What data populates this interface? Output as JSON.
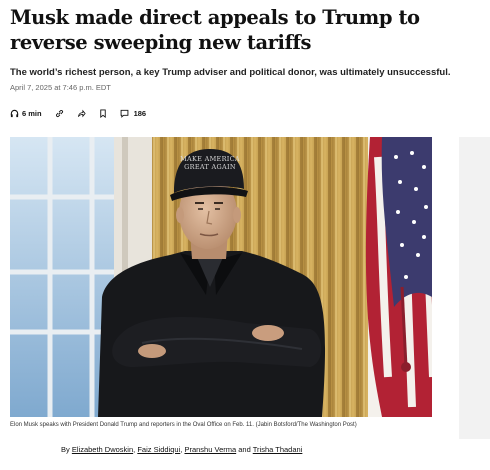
{
  "article": {
    "headline": "Musk made direct appeals to Trump to reverse sweeping new tariffs",
    "dek": "The world’s richest person, a key Trump adviser and political donor, was ultimately unsuccessful.",
    "dateline": "April 7, 2025 at 7:46 p.m. EDT"
  },
  "toolbar": {
    "listen_label": "6 min",
    "comments_count": "186",
    "icons": [
      "headphones-icon",
      "gift-link-icon",
      "share-icon",
      "bookmark-icon",
      "comment-icon"
    ]
  },
  "photo": {
    "cap_text_line1": "MAKE AMERICA",
    "cap_text_line2": "GREAT AGAIN",
    "caption": "Elon Musk speaks with President Donald Trump and reporters in the Oval Office on Feb. 11. (Jabin Botsford/The Washington Post)"
  },
  "byline": {
    "prefix": "By",
    "authors": [
      "Elizabeth Dwoskin",
      "Faiz Siddiqui",
      "Pranshu Verma",
      "Trisha Thadani"
    ],
    "sep_comma": ",",
    "sep_and": "and"
  },
  "colors": {
    "curtain_gold": "#c9a24e",
    "flag_red": "#b22234",
    "flag_blue": "#3c3b6e",
    "window_blue": "#9fc1e0"
  }
}
